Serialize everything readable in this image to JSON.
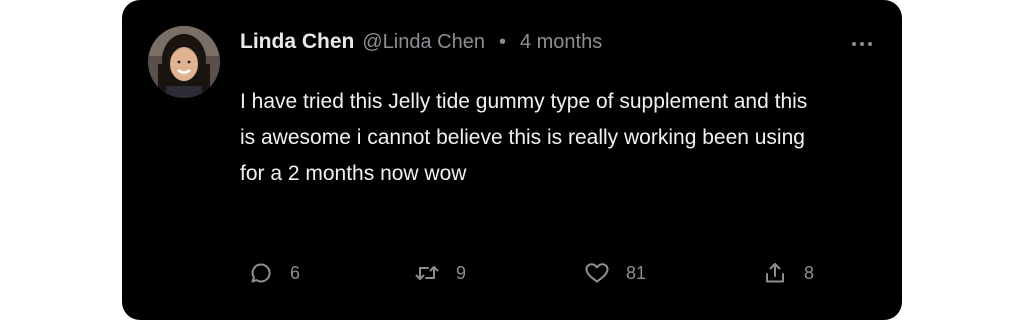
{
  "tweet": {
    "author": {
      "display_name": "Linda Chen",
      "handle": "@Linda Chen"
    },
    "separator": "•",
    "time": "4 months",
    "text": "I have tried this Jelly tide gummy type of supplement and this is awesome i cannot believe this is really working been using for a 2 months now wow",
    "actions": {
      "replies": "6",
      "retweets": "9",
      "likes": "81",
      "shares": "8"
    }
  },
  "icons": {
    "more": "more-horizontal-icon",
    "reply": "reply-icon",
    "retweet": "retweet-icon",
    "like": "heart-icon",
    "share": "share-icon"
  },
  "colors": {
    "card_background": "#000000",
    "primary_text": "#e7e9ea",
    "secondary_text": "#8b8f94"
  }
}
